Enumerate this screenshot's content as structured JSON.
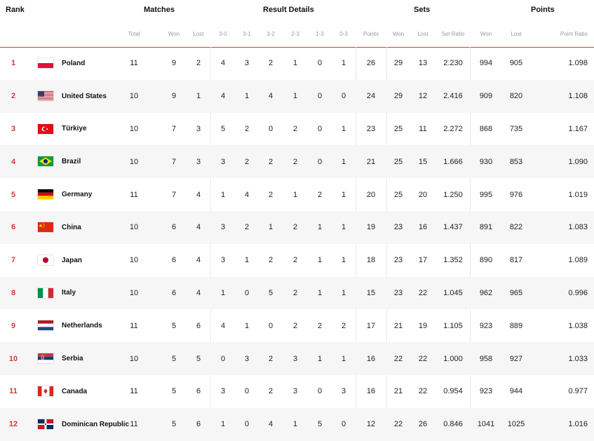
{
  "headers": {
    "rank": "Rank",
    "matches": "Matches",
    "result_details": "Result Details",
    "sets": "Sets",
    "points": "Points",
    "sub": {
      "total": "Total",
      "won": "Won",
      "lost": "Lost",
      "r30": "3-0",
      "r31": "3-1",
      "r32": "3-2",
      "r23": "2-3",
      "r13": "1-3",
      "r03": "0-3",
      "pts": "Points",
      "sets_won": "Won",
      "sets_lost": "Lost",
      "set_ratio": "Set Ratio",
      "points_won": "Won",
      "points_lost": "Lost",
      "point_ratio": "Point Ratio"
    }
  },
  "rows": [
    {
      "rank": "1",
      "team": "Poland",
      "flag": "poland-flag",
      "total": "11",
      "won": "9",
      "lost": "2",
      "r30": "4",
      "r31": "3",
      "r32": "2",
      "r23": "1",
      "r13": "0",
      "r03": "1",
      "pts": "26",
      "sw": "29",
      "sl": "13",
      "sr": "2.230",
      "pw": "994",
      "pl": "905",
      "pr": "1.098"
    },
    {
      "rank": "2",
      "team": "United States",
      "flag": "usa-flag",
      "total": "10",
      "won": "9",
      "lost": "1",
      "r30": "4",
      "r31": "1",
      "r32": "4",
      "r23": "1",
      "r13": "0",
      "r03": "0",
      "pts": "24",
      "sw": "29",
      "sl": "12",
      "sr": "2.416",
      "pw": "909",
      "pl": "820",
      "pr": "1.108"
    },
    {
      "rank": "3",
      "team": "Türkiye",
      "flag": "turkiye-flag",
      "total": "10",
      "won": "7",
      "lost": "3",
      "r30": "5",
      "r31": "2",
      "r32": "0",
      "r23": "2",
      "r13": "0",
      "r03": "1",
      "pts": "23",
      "sw": "25",
      "sl": "11",
      "sr": "2.272",
      "pw": "868",
      "pl": "735",
      "pr": "1.167"
    },
    {
      "rank": "4",
      "team": "Brazil",
      "flag": "brazil-flag",
      "total": "10",
      "won": "7",
      "lost": "3",
      "r30": "3",
      "r31": "2",
      "r32": "2",
      "r23": "2",
      "r13": "0",
      "r03": "1",
      "pts": "21",
      "sw": "25",
      "sl": "15",
      "sr": "1.666",
      "pw": "930",
      "pl": "853",
      "pr": "1.090"
    },
    {
      "rank": "5",
      "team": "Germany",
      "flag": "germany-flag",
      "total": "11",
      "won": "7",
      "lost": "4",
      "r30": "1",
      "r31": "4",
      "r32": "2",
      "r23": "1",
      "r13": "2",
      "r03": "1",
      "pts": "20",
      "sw": "25",
      "sl": "20",
      "sr": "1.250",
      "pw": "995",
      "pl": "976",
      "pr": "1.019"
    },
    {
      "rank": "6",
      "team": "China",
      "flag": "china-flag",
      "total": "10",
      "won": "6",
      "lost": "4",
      "r30": "3",
      "r31": "2",
      "r32": "1",
      "r23": "2",
      "r13": "1",
      "r03": "1",
      "pts": "19",
      "sw": "23",
      "sl": "16",
      "sr": "1.437",
      "pw": "891",
      "pl": "822",
      "pr": "1.083"
    },
    {
      "rank": "7",
      "team": "Japan",
      "flag": "japan-flag",
      "total": "10",
      "won": "6",
      "lost": "4",
      "r30": "3",
      "r31": "1",
      "r32": "2",
      "r23": "2",
      "r13": "1",
      "r03": "1",
      "pts": "18",
      "sw": "23",
      "sl": "17",
      "sr": "1.352",
      "pw": "890",
      "pl": "817",
      "pr": "1.089"
    },
    {
      "rank": "8",
      "team": "Italy",
      "flag": "italy-flag",
      "total": "10",
      "won": "6",
      "lost": "4",
      "r30": "1",
      "r31": "0",
      "r32": "5",
      "r23": "2",
      "r13": "1",
      "r03": "1",
      "pts": "15",
      "sw": "23",
      "sl": "22",
      "sr": "1.045",
      "pw": "962",
      "pl": "965",
      "pr": "0.996"
    },
    {
      "rank": "9",
      "team": "Netherlands",
      "flag": "netherlands-flag",
      "total": "11",
      "won": "5",
      "lost": "6",
      "r30": "4",
      "r31": "1",
      "r32": "0",
      "r23": "2",
      "r13": "2",
      "r03": "2",
      "pts": "17",
      "sw": "21",
      "sl": "19",
      "sr": "1.105",
      "pw": "923",
      "pl": "889",
      "pr": "1.038"
    },
    {
      "rank": "10",
      "team": "Serbia",
      "flag": "serbia-flag",
      "total": "10",
      "won": "5",
      "lost": "5",
      "r30": "0",
      "r31": "3",
      "r32": "2",
      "r23": "3",
      "r13": "1",
      "r03": "1",
      "pts": "16",
      "sw": "22",
      "sl": "22",
      "sr": "1.000",
      "pw": "958",
      "pl": "927",
      "pr": "1.033"
    },
    {
      "rank": "11",
      "team": "Canada",
      "flag": "canada-flag",
      "total": "11",
      "won": "5",
      "lost": "6",
      "r30": "3",
      "r31": "0",
      "r32": "2",
      "r23": "3",
      "r13": "0",
      "r03": "3",
      "pts": "16",
      "sw": "21",
      "sl": "22",
      "sr": "0.954",
      "pw": "923",
      "pl": "944",
      "pr": "0.977"
    },
    {
      "rank": "12",
      "team": "Dominican Republic",
      "flag": "dominican-republic-flag",
      "total": "11",
      "won": "5",
      "lost": "6",
      "r30": "1",
      "r31": "0",
      "r32": "4",
      "r23": "1",
      "r13": "5",
      "r03": "0",
      "pts": "12",
      "sw": "22",
      "sl": "26",
      "sr": "0.846",
      "pw": "1041",
      "pl": "1025",
      "pr": "1.016"
    }
  ],
  "colors": {
    "accent": "#d6393b",
    "alt_row": "#f6f6f6"
  }
}
